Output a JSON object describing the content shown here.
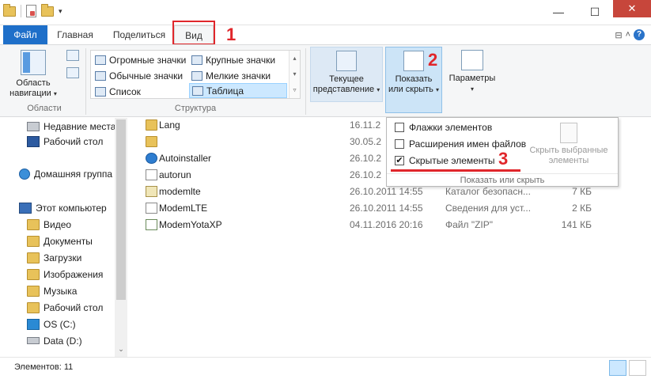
{
  "tabs": {
    "file": "Файл",
    "home": "Главная",
    "share": "Поделиться",
    "view": "Вид"
  },
  "annotations": {
    "n1": "1",
    "n2": "2",
    "n3": "3",
    "color": "#e0262b"
  },
  "window": {
    "minimize": "—",
    "maximize": "☐",
    "close": "✕"
  },
  "ribbon": {
    "nav_pane": {
      "label_line1": "Область",
      "label_line2": "навигации"
    },
    "areas_group": "Области",
    "layout_group": "Структура",
    "layout_items": [
      {
        "label": "Огромные значки"
      },
      {
        "label": "Крупные значки"
      },
      {
        "label": "Обычные значки"
      },
      {
        "label": "Мелкие значки"
      },
      {
        "label": "Список"
      },
      {
        "label": "Таблица"
      }
    ],
    "current_view": {
      "line1": "Текущее",
      "line2": "представление"
    },
    "show_hide": {
      "line1": "Показать",
      "line2": "или скрыть"
    },
    "options": {
      "label": "Параметры"
    }
  },
  "popup": {
    "items": [
      {
        "label": "Флажки элементов",
        "checked": false
      },
      {
        "label": "Расширения имен файлов",
        "checked": false
      },
      {
        "label": "Скрытые элементы",
        "checked": true
      }
    ],
    "hide_selected": {
      "line1": "Скрыть выбранные",
      "line2": "элементы"
    },
    "footer": "Показать или скрыть"
  },
  "nav": [
    {
      "label": "Недавние места",
      "icon": "recent-places-icon"
    },
    {
      "label": "Рабочий стол",
      "icon": "desktop-icon"
    },
    {
      "label": "Домашняя группа",
      "icon": "homegroup-icon"
    },
    {
      "label": "Этот компьютер",
      "icon": "computer-icon"
    },
    {
      "label": "Видео",
      "icon": "folder-icon"
    },
    {
      "label": "Документы",
      "icon": "folder-icon"
    },
    {
      "label": "Загрузки",
      "icon": "folder-icon"
    },
    {
      "label": "Изображения",
      "icon": "folder-icon"
    },
    {
      "label": "Музыка",
      "icon": "folder-icon"
    },
    {
      "label": "Рабочий стол",
      "icon": "folder-icon"
    },
    {
      "label": "OS (C:)",
      "icon": "windows-drive-icon"
    },
    {
      "label": "Data (D:)",
      "icon": "drive-icon"
    }
  ],
  "files": [
    {
      "name": "Lang",
      "date": "16.11.2",
      "type": "",
      "size": "",
      "icon": "folder-icon"
    },
    {
      "name": "",
      "date": "30.05.2",
      "type": "",
      "size": "",
      "icon": "folder-icon"
    },
    {
      "name": "Autoinstaller",
      "date": "26.10.2",
      "type": "",
      "size": "",
      "icon": "app-icon"
    },
    {
      "name": "autorun",
      "date": "26.10.2",
      "type": "",
      "size": "",
      "icon": "settings-file-icon"
    },
    {
      "name": "modemlte",
      "date": "26.10.2011 14:55",
      "type": "Каталог безопасн...",
      "size": "7 КБ",
      "icon": "script-file-icon"
    },
    {
      "name": "ModemLTE",
      "date": "26.10.2011 14:55",
      "type": "Сведения для уст...",
      "size": "2 КБ",
      "icon": "info-file-icon"
    },
    {
      "name": "ModemYotaXP",
      "date": "04.11.2016 20:16",
      "type": "Файл \"ZIP\"",
      "size": "141 КБ",
      "icon": "zip-file-icon"
    }
  ],
  "status": {
    "items_count": "Элементов: 11"
  }
}
